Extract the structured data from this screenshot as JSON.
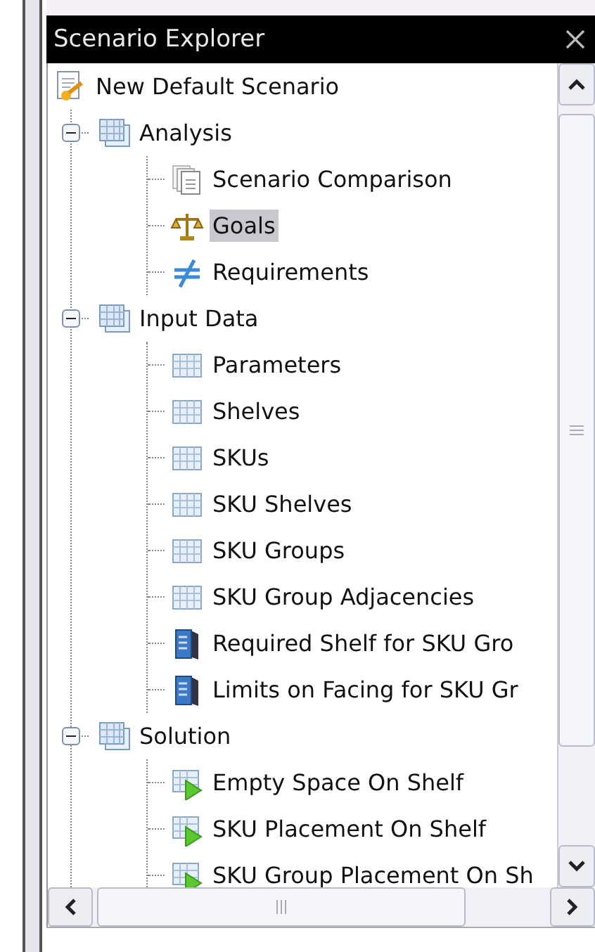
{
  "panel": {
    "title": "Scenario Explorer"
  },
  "tree": [
    {
      "label": "New Default Scenario",
      "kind": "scenario",
      "selected": false,
      "children": [
        {
          "label": "Analysis",
          "kind": "group",
          "expanded": true,
          "selected": false,
          "children": [
            {
              "label": "Scenario Comparison",
              "kind": "comparison",
              "selected": false
            },
            {
              "label": "Goals",
              "kind": "scale",
              "selected": true
            },
            {
              "label": "Requirements",
              "kind": "not-equal",
              "selected": false
            }
          ]
        },
        {
          "label": "Input Data",
          "kind": "group",
          "expanded": true,
          "selected": false,
          "children": [
            {
              "label": "Parameters",
              "kind": "table",
              "selected": false
            },
            {
              "label": "Shelves",
              "kind": "table",
              "selected": false
            },
            {
              "label": "SKUs",
              "kind": "table",
              "selected": false
            },
            {
              "label": "SKU Shelves",
              "kind": "table",
              "selected": false
            },
            {
              "label": "SKU Groups",
              "kind": "table",
              "selected": false
            },
            {
              "label": "SKU Group Adjacencies",
              "kind": "table",
              "selected": false
            },
            {
              "label": "Required Shelf for SKU Gro",
              "kind": "database",
              "selected": false
            },
            {
              "label": "Limits on Facing for SKU Gr",
              "kind": "database",
              "selected": false
            }
          ]
        },
        {
          "label": "Solution",
          "kind": "group",
          "expanded": true,
          "selected": false,
          "children": [
            {
              "label": "Empty Space On Shelf",
              "kind": "table-run",
              "selected": false
            },
            {
              "label": "SKU Placement On Shelf",
              "kind": "table-run",
              "selected": false
            },
            {
              "label": "SKU Group Placement On Sh",
              "kind": "table-run",
              "selected": false
            }
          ]
        }
      ]
    }
  ]
}
